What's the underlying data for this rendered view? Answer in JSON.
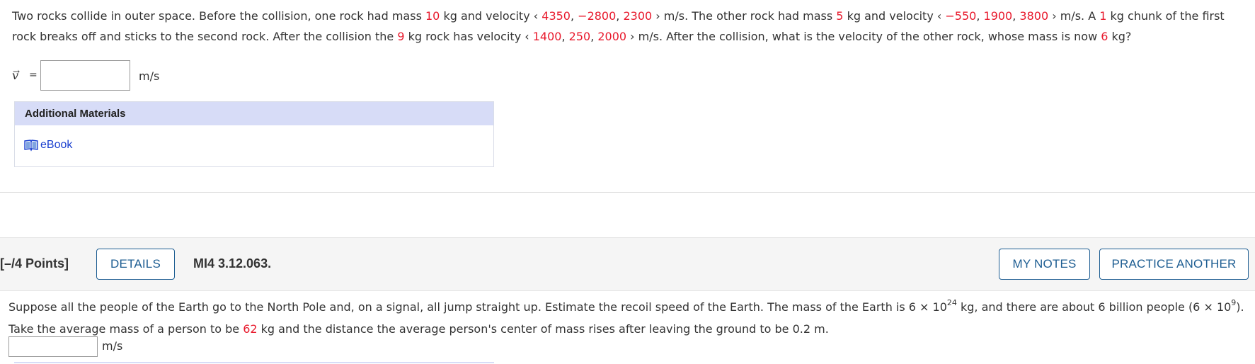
{
  "question1": {
    "t1": "Two rocks collide in outer space. Before the collision, one rock had mass ",
    "m1": "10",
    "t2": " kg and velocity ",
    "open_bracket": "‹",
    "v1x": "4350",
    "comma": ", ",
    "v1y": "−2800",
    "v1z": "2300",
    "close_bracket": "›",
    "t3": " m/s. The other rock had mass ",
    "m2": "5",
    "t4": " kg and velocity ",
    "v2x": "−550",
    "v2y": "1900",
    "v2z": "3800",
    "t5": " m/s. A ",
    "chunk": "1",
    "t6": " kg chunk of the first rock breaks off and sticks to the second rock. After the collision the ",
    "m3": "9",
    "t7": " kg rock has velocity ",
    "v3x": "1400",
    "v3y": "250",
    "v3z": "2000",
    "t8": " m/s. After the collision, what is the velocity of the other rock, whose mass is now ",
    "m4": "6",
    "t9": " kg?",
    "answer_symbol": "v",
    "answer_arrow": "→",
    "equals": "=",
    "answer_value": "",
    "unit": "m/s"
  },
  "additional_materials": {
    "heading": "Additional Materials",
    "ebook_label": "eBook",
    "ebook_icon": "book-icon"
  },
  "question2_bar": {
    "points": "[–/4 Points]",
    "details_label": "DETAILS",
    "question_id": "MI4 3.12.063.",
    "my_notes_label": "MY NOTES",
    "practice_another_label": "PRACTICE ANOTHER"
  },
  "question2": {
    "t1": "Suppose all the people of the Earth go to the North Pole and, on a signal, all jump straight up. Estimate the recoil speed of the Earth. The mass of the Earth is 6 × 10",
    "exp1": "24",
    "t2": " kg, and there are about 6 billion people (6 × 10",
    "exp2": "9",
    "t3": "). Take the average mass of a person to be ",
    "person_mass": "62",
    "t4": " kg and the distance the average person's center of mass rises after leaving the ground to be 0.2 m.",
    "answer_value": "",
    "unit": "m/s"
  },
  "colors": {
    "given_value": "#e8192c",
    "link": "#1a3fcf",
    "button": "#1d5d92",
    "header_bg": "#d7dcf7"
  }
}
